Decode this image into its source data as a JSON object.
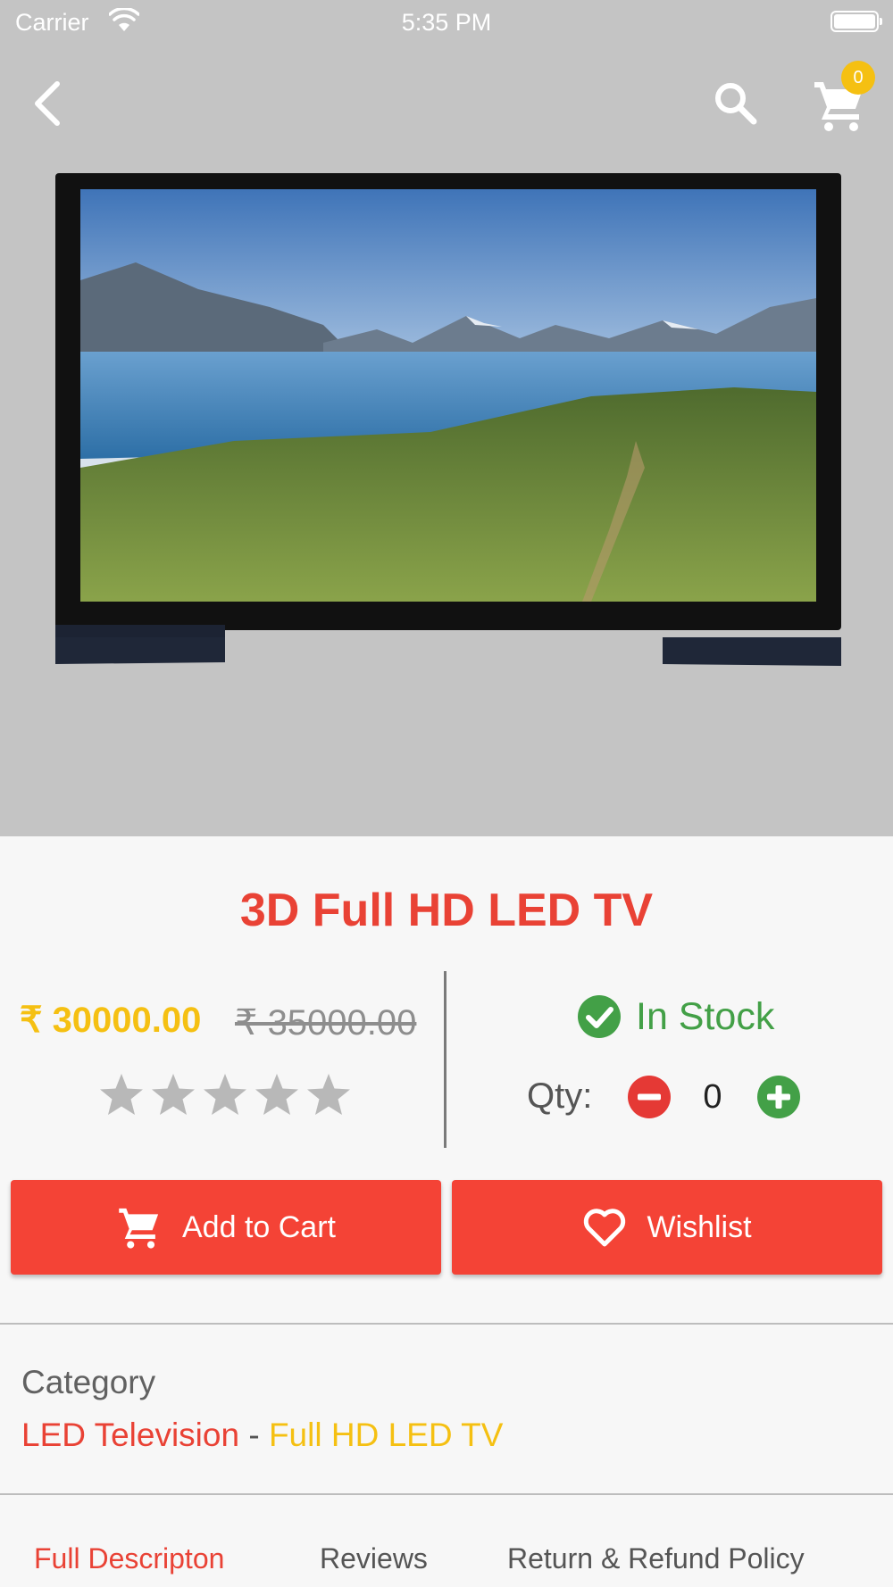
{
  "status_bar": {
    "carrier": "Carrier",
    "time": "5:35 PM"
  },
  "header": {
    "cart_count": "0"
  },
  "product": {
    "title": "3D Full HD LED TV",
    "price": "₹ 30000.00",
    "old_price": "₹ 35000.00",
    "rating": 0,
    "rating_max": 5,
    "stock_status": "In Stock",
    "qty_label": "Qty:",
    "qty_value": "0"
  },
  "actions": {
    "add_to_cart": "Add to Cart",
    "wishlist": "Wishlist"
  },
  "category": {
    "heading": "Category",
    "main": "LED Television",
    "separator": " - ",
    "sub": "Full HD LED TV"
  },
  "tabs": [
    {
      "label": "Full Descripton",
      "active": true
    },
    {
      "label": "Reviews",
      "active": false
    },
    {
      "label": "Return & Refund Policy",
      "active": false
    }
  ],
  "colors": {
    "accent_red": "#f44336",
    "title_red": "#e94235",
    "price_yellow": "#f5c012",
    "stock_green": "#43a047",
    "hero_background": "#c4c4c4"
  },
  "icons": {
    "back": "chevron-left-icon",
    "search": "search-icon",
    "cart": "cart-icon",
    "stock": "check-circle-icon",
    "minus": "minus-circle-icon",
    "plus": "plus-circle-icon",
    "wishlist": "heart-outline-icon",
    "star": "star-icon"
  }
}
